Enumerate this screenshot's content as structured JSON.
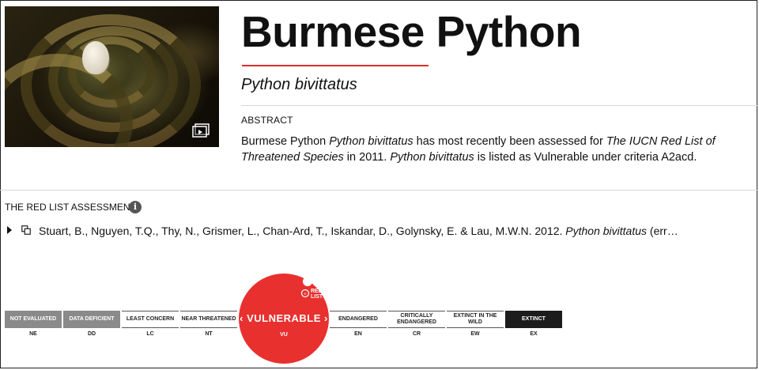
{
  "species": {
    "common_name": "Burmese Python",
    "scientific_name": "Python bivittatus"
  },
  "photo": {
    "alt": "Burmese Python coiled around eggs",
    "icons": [
      "gallery-icon"
    ]
  },
  "abstract": {
    "label": "ABSTRACT",
    "segments": [
      {
        "text": "Burmese Python ",
        "italic": false
      },
      {
        "text": "Python bivittatus",
        "italic": true
      },
      {
        "text": " has most recently been assessed for ",
        "italic": false
      },
      {
        "text": "The IUCN Red List of Threatened Species",
        "italic": true
      },
      {
        "text": " in 2011. ",
        "italic": false
      },
      {
        "text": "Python bivittatus",
        "italic": true
      },
      {
        "text": " is listed as Vulnerable under criteria A2acd.",
        "italic": false
      }
    ]
  },
  "assessment": {
    "label": "THE RED LIST ASSESSMENT",
    "info_icon": "info-icon",
    "toggle_icon": "expand-arrow-icon",
    "copy_icon": "copy-icon",
    "citation": {
      "authors": "Stuart, B., Nguyen, T.Q., Thy, N., Grismer, L., Chan-Ard, T., Iskandar, D., Golynsky, E. & Lau, M.W.N. 2012. ",
      "species": "Python bivittatus",
      "tail": " (err…"
    }
  },
  "categories": [
    {
      "label": "NOT EVALUATED",
      "code": "NE",
      "style": "grey"
    },
    {
      "label": "DATA DEFICIENT",
      "code": "DD",
      "style": "grey"
    },
    {
      "label": "LEAST CONCERN",
      "code": "LC",
      "style": "white"
    },
    {
      "label": "NEAR THREATENED",
      "code": "NT",
      "style": "white"
    },
    {
      "label": "VULNERABLE",
      "code": "VU",
      "style": "selected"
    },
    {
      "label": "ENDANGERED",
      "code": "EN",
      "style": "white"
    },
    {
      "label": "CRITICALLY ENDANGERED",
      "code": "CR",
      "style": "white"
    },
    {
      "label": "EXTINCT IN THE WILD",
      "code": "EW",
      "style": "white"
    },
    {
      "label": "EXTINCT",
      "code": "EX",
      "style": "dark"
    }
  ],
  "selected_category": {
    "label": "VULNERABLE",
    "code": "VU",
    "display": "‹ VULNERABLE ›",
    "logo_text": "RED LIST"
  },
  "colors": {
    "accent_red": "#e8312f",
    "rule_red": "#d9302a",
    "grey_category": "#8a8a8a",
    "dark_category": "#1c1c1c"
  }
}
